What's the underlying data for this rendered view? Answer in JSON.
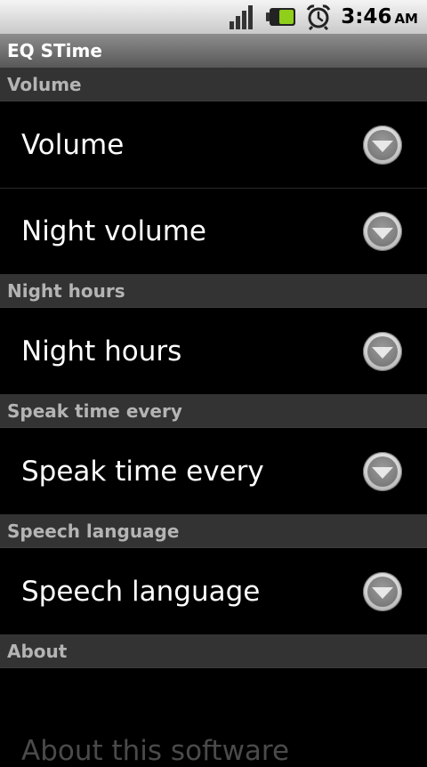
{
  "status_bar": {
    "time": "3:46",
    "ampm": "AM",
    "icons": [
      "signal-icon",
      "battery-icon",
      "alarm-clock-icon"
    ]
  },
  "app": {
    "title": "EQ STime"
  },
  "sections": [
    {
      "header": "Volume",
      "items": [
        {
          "label": "Volume"
        },
        {
          "label": "Night volume"
        }
      ]
    },
    {
      "header": "Night hours",
      "items": [
        {
          "label": "Night hours"
        }
      ]
    },
    {
      "header": "Speak time every",
      "items": [
        {
          "label": "Speak time every"
        }
      ]
    },
    {
      "header": "Speech language",
      "items": [
        {
          "label": "Speech language"
        }
      ]
    },
    {
      "header": "About",
      "items": [
        {
          "label": "About this software"
        }
      ]
    }
  ],
  "colors": {
    "battery_fill": "#8fce1a",
    "section_header_bg": "#333333",
    "section_header_text": "#b4b4b4"
  }
}
